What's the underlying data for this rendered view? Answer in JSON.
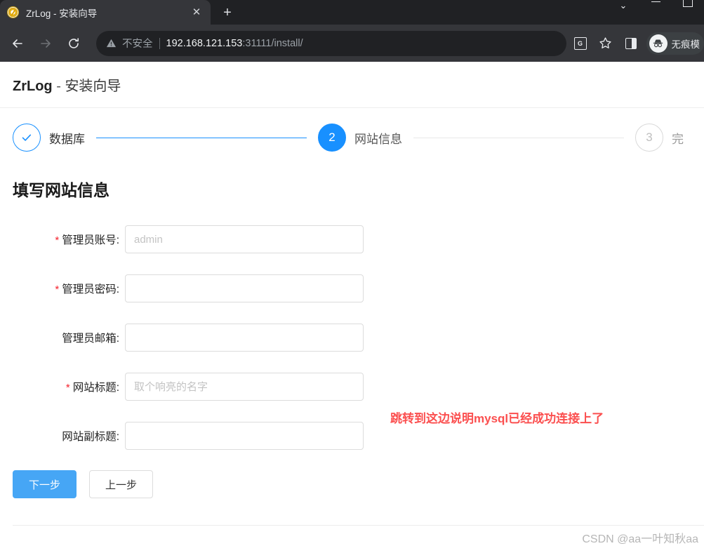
{
  "browser": {
    "tab": {
      "title": "ZrLog - 安装向导",
      "favicon": "zrlog-favicon",
      "close": "✕"
    },
    "new_tab": "+",
    "window_controls": {
      "chevron": "⌄",
      "minimize": "minimize-icon",
      "maximize": "maximize-icon"
    },
    "nav": {
      "back": "←",
      "forward": "→",
      "reload": "⟳"
    },
    "omnibox": {
      "security_icon": "warning-triangle-icon",
      "security_text": "不安全",
      "url_host": "192.168.121.153",
      "url_rest": ":31111/install/"
    },
    "actions": {
      "translate": "G",
      "bookmark": "☆",
      "side_panel": "side-panel-icon",
      "incognito_label": "无痕模"
    }
  },
  "page": {
    "brand_name": "ZrLog",
    "brand_dash": " - ",
    "brand_sub": "安装向导",
    "steps": [
      {
        "index": "✓",
        "label": "数据库",
        "state": "done"
      },
      {
        "index": "2",
        "label": "网站信息",
        "state": "active"
      },
      {
        "index": "3",
        "label": "完",
        "state": "todo"
      }
    ],
    "form_title": "填写网站信息",
    "fields": [
      {
        "label": "管理员账号:",
        "required": true,
        "value": "",
        "placeholder": "admin"
      },
      {
        "label": "管理员密码:",
        "required": true,
        "value": "",
        "placeholder": ""
      },
      {
        "label": "管理员邮箱:",
        "required": false,
        "value": "",
        "placeholder": ""
      },
      {
        "label": "网站标题:",
        "required": true,
        "value": "",
        "placeholder": "取个响亮的名字"
      },
      {
        "label": "网站副标题:",
        "required": false,
        "value": "",
        "placeholder": ""
      }
    ],
    "annotation": "跳转到这边说明mysql已经成功连接上了",
    "buttons": {
      "next": "下一步",
      "prev": "上一步"
    },
    "watermark": "CSDN @aa一叶知秋aa",
    "colors": {
      "accent": "#1890ff",
      "primary_button": "#46a6f5",
      "required_mark": "#f5222d",
      "annotation": "#fb4f4f"
    }
  }
}
